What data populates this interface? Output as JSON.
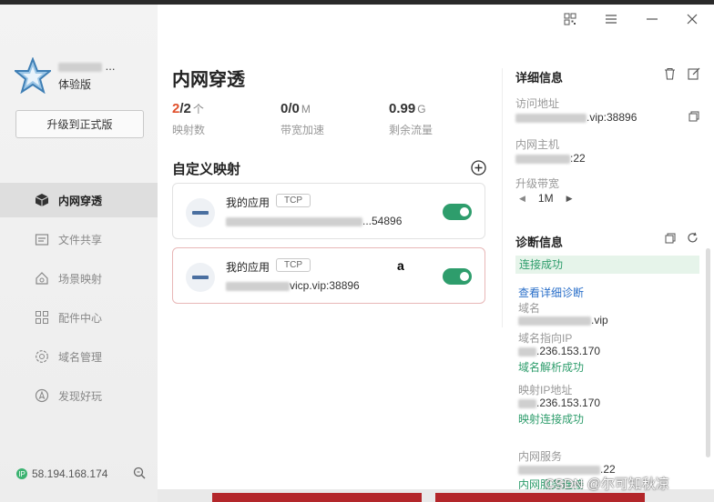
{
  "sidebar": {
    "username": "...",
    "edition": "体验版",
    "upgrade_label": "升级到正式版",
    "items": [
      {
        "label": "内网穿透",
        "icon": "cube-icon"
      },
      {
        "label": "文件共享",
        "icon": "folder-icon"
      },
      {
        "label": "场景映射",
        "icon": "house-icon"
      },
      {
        "label": "配件中心",
        "icon": "grid-icon"
      },
      {
        "label": "域名管理",
        "icon": "gear-globe-icon"
      },
      {
        "label": "发现好玩",
        "icon": "compass-icon"
      }
    ],
    "ip": "58.194.168.174",
    "ip_badge": "IP"
  },
  "main": {
    "title": "内网穿透",
    "stats": [
      {
        "value_red": "2",
        "value": "/2",
        "unit": "个",
        "label": "映射数"
      },
      {
        "value_red": "",
        "value": "0/0",
        "unit": "M",
        "label": "带宽加速"
      },
      {
        "value_red": "",
        "value": "0.99",
        "unit": "G",
        "label": "剩余流量"
      }
    ],
    "custom_title": "自定义映射",
    "mappings": [
      {
        "name": "我的应用",
        "protocol": "TCP",
        "address": "...54896",
        "enabled": true
      },
      {
        "name": "我的应用",
        "protocol": "TCP",
        "address": "vicp.vip:38896",
        "enabled": true
      }
    ],
    "cursor_text": "a"
  },
  "details": {
    "title": "详细信息",
    "access_label": "访问地址",
    "access_value": ".vip:38896",
    "host_label": "内网主机",
    "host_value": ":22",
    "bandwidth_label": "升级带宽",
    "bandwidth_value": "1M"
  },
  "diagnosis": {
    "title": "诊断信息",
    "status": "连接成功",
    "view_link": "查看详细诊断",
    "domain_label": "域名",
    "domain_value": ".vip",
    "domain_ip_label": "域名指向IP",
    "domain_ip_value": ".236.153.170",
    "domain_resolve_status": "域名解析成功",
    "mapping_ip_label": "映射IP地址",
    "mapping_ip_value": ".236.153.170",
    "mapping_conn_status": "映射连接成功",
    "service_label": "内网服务",
    "service_value": ".22",
    "service_status": "内网服务连接"
  },
  "watermark": "CSDN @尔可知秋凉",
  "colors": {
    "accent_green": "#2e9d6c",
    "accent_red": "#e0502b",
    "link_blue": "#2a6fc9"
  }
}
